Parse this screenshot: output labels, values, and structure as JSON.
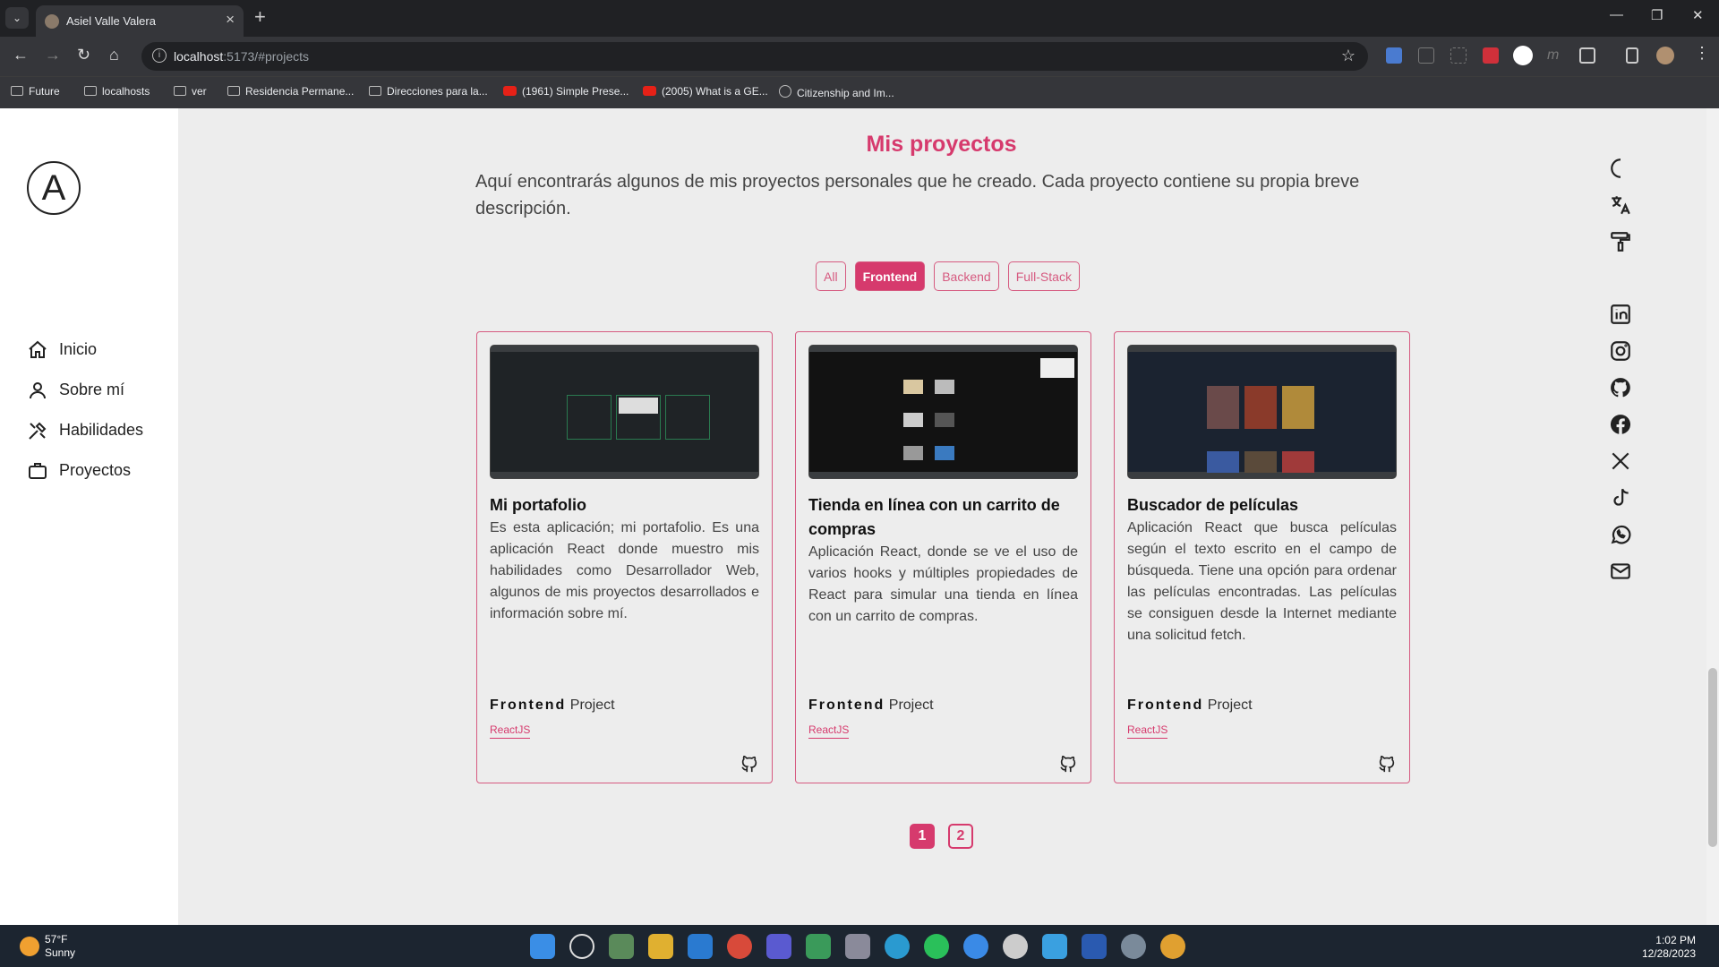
{
  "browser": {
    "tab_title": "Asiel Valle Valera",
    "url_host": "localhost",
    "url_rest": ":5173/#projects",
    "bookmarks": [
      "Future",
      "localhosts",
      "ver",
      "Residencia Permane...",
      "Direcciones para la...",
      "(1961) Simple Prese...",
      "(2005) What is a GE...",
      "Citizenship and Im..."
    ]
  },
  "sidebar": {
    "logo_letter": "A",
    "items": [
      {
        "label": "Inicio",
        "icon": "home-icon"
      },
      {
        "label": "Sobre mí",
        "icon": "user-icon"
      },
      {
        "label": "Habilidades",
        "icon": "tools-icon"
      },
      {
        "label": "Proyectos",
        "icon": "briefcase-icon"
      }
    ]
  },
  "projects": {
    "title": "Mis proyectos",
    "description": "Aquí encontrarás algunos de mis proyectos personales que he creado. Cada proyecto contiene su propia breve descripción.",
    "filters": [
      "All",
      "Frontend",
      "Backend",
      "Full-Stack"
    ],
    "active_filter": "Frontend",
    "cards": [
      {
        "title": "Mi portafolio",
        "description": "Es esta aplicación; mi portafolio. Es una aplicación React donde muestro mis habilidades como Desarrollador Web, algunos de mis proyectos desarrollados e información sobre mí.",
        "type": "Frontend",
        "type_suffix": "Project",
        "tag": "ReactJS"
      },
      {
        "title": "Tienda en línea con un carrito de compras",
        "description": "Aplicación React, donde se ve el uso de varios hooks y múltiples propiedades de React para simular una tienda en línea con un carrito de compras.",
        "type": "Frontend",
        "type_suffix": "Project",
        "tag": "ReactJS"
      },
      {
        "title": "Buscador de películas",
        "description": "Aplicación React que busca películas según el texto escrito en el campo de búsqueda. Tiene una opción para ordenar las películas encontradas. Las películas se consiguen desde la Internet mediante una solicitud fetch.",
        "type": "Frontend",
        "type_suffix": "Project",
        "tag": "ReactJS"
      }
    ],
    "pages": [
      "1",
      "2"
    ],
    "active_page": "1"
  },
  "right_icons": [
    "moon-icon",
    "translate-icon",
    "paint-roller-icon",
    "linkedin-icon",
    "instagram-icon",
    "github-icon",
    "facebook-icon",
    "x-icon",
    "tiktok-icon",
    "whatsapp-icon",
    "mail-icon"
  ],
  "taskbar": {
    "temperature": "57°F",
    "condition": "Sunny",
    "time": "1:02 PM",
    "date": "12/28/2023"
  },
  "colors": {
    "accent": "#d63a6d",
    "page_bg": "#ededed",
    "sidebar_bg": "#ffffff"
  }
}
